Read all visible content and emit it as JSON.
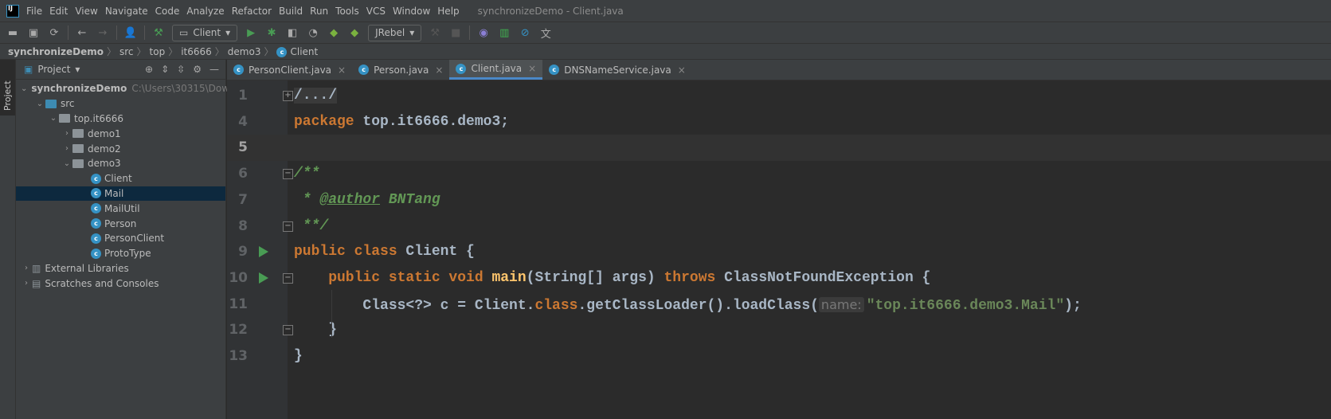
{
  "menubar": {
    "logo": "IJ",
    "items": [
      "File",
      "Edit",
      "View",
      "Navigate",
      "Code",
      "Analyze",
      "Refactor",
      "Build",
      "Run",
      "Tools",
      "VCS",
      "Window",
      "Help"
    ],
    "title": "synchronizeDemo - Client.java"
  },
  "toolbar": {
    "run_config": "Client",
    "jrebel": "JRebel"
  },
  "breadcrumb": [
    "synchronizeDemo",
    "src",
    "top",
    "it6666",
    "demo3",
    "Client"
  ],
  "sidebar": {
    "stripe_label": "Project",
    "panel_title": "Project",
    "tree": [
      {
        "label": "synchronizeDemo",
        "path": "C:\\Users\\30315\\Dow",
        "depth": 0,
        "expanded": true,
        "type": "module"
      },
      {
        "label": "src",
        "depth": 1,
        "expanded": true,
        "type": "src"
      },
      {
        "label": "top.it6666",
        "depth": 2,
        "expanded": true,
        "type": "package"
      },
      {
        "label": "demo1",
        "depth": 3,
        "expanded": false,
        "type": "package"
      },
      {
        "label": "demo2",
        "depth": 3,
        "expanded": false,
        "type": "package"
      },
      {
        "label": "demo3",
        "depth": 3,
        "expanded": true,
        "type": "package"
      },
      {
        "label": "Client",
        "depth": 4,
        "type": "class"
      },
      {
        "label": "Mail",
        "depth": 4,
        "type": "class",
        "selected": true
      },
      {
        "label": "MailUtil",
        "depth": 4,
        "type": "class"
      },
      {
        "label": "Person",
        "depth": 4,
        "type": "class"
      },
      {
        "label": "PersonClient",
        "depth": 4,
        "type": "class"
      },
      {
        "label": "ProtoType",
        "depth": 4,
        "type": "class"
      },
      {
        "label": "External Libraries",
        "depth": 0,
        "expanded": false,
        "type": "libs"
      },
      {
        "label": "Scratches and Consoles",
        "depth": 0,
        "expanded": false,
        "type": "scratch"
      }
    ]
  },
  "tabs": [
    {
      "label": "PersonClient.java"
    },
    {
      "label": "Person.java"
    },
    {
      "label": "Client.java",
      "active": true
    },
    {
      "label": "DNSNameService.java"
    }
  ],
  "editor": {
    "line_numbers": [
      "1",
      "4",
      "5",
      "6",
      "7",
      "8",
      "9",
      "10",
      "11",
      "12",
      "13"
    ],
    "current_line": "5",
    "lines": {
      "l1": "/.../",
      "l4a": "package",
      "l4b": " top.it6666.demo3;",
      "l6": "/**",
      "l7a": " * ",
      "l7b": "@author",
      "l7c": " BNTang",
      "l8": " **/",
      "l9a": "public class",
      "l9b": " Client {",
      "l10a": "    public static void ",
      "l10b": "main",
      "l10c": "(String[] args) ",
      "l10d": "throws",
      "l10e": " ClassNotFoundException {",
      "l11a": "        Class<?> c = Client.",
      "l11b": "class",
      "l11c": ".getClassLoader().loadClass(",
      "l11hint": "name:",
      "l11d": "\"top.it6666.demo3.Mail\"",
      "l11e": ");",
      "l12": "    }",
      "l13": "}"
    }
  },
  "colors": {
    "keyword": "#cc7832",
    "string": "#6a8759",
    "comment": "#629755",
    "method": "#ffc66d",
    "selection": "#0d293e"
  }
}
